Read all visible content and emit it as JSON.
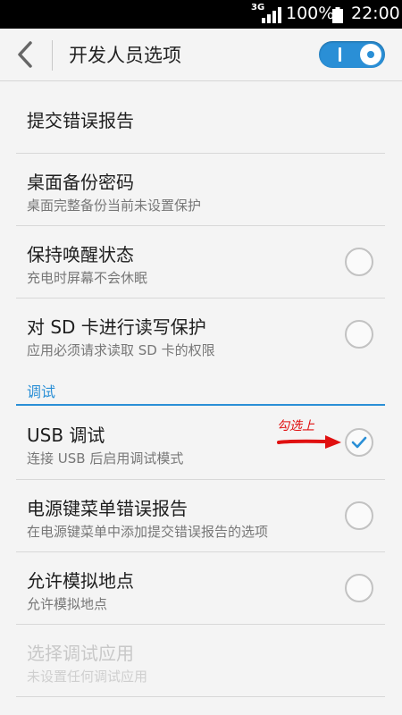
{
  "status_bar": {
    "network": "3G",
    "battery_percent": "100%",
    "time": "22:00"
  },
  "title_bar": {
    "title": "开发人员选项",
    "master_switch_on": true
  },
  "settings": [
    {
      "title": "提交错误报告",
      "subtitle": "",
      "control": "none"
    },
    {
      "title": "桌面备份密码",
      "subtitle": "桌面完整备份当前未设置保护",
      "control": "none"
    },
    {
      "title": "保持唤醒状态",
      "subtitle": "充电时屏幕不会休眠",
      "control": "radio",
      "checked": false
    },
    {
      "title": "对 SD 卡进行读写保护",
      "subtitle": "应用必须请求读取 SD 卡的权限",
      "control": "radio",
      "checked": false
    }
  ],
  "debug_section": {
    "header": "调试",
    "items": [
      {
        "title": "USB 调试",
        "subtitle": "连接 USB 后启用调试模式",
        "control": "radio",
        "checked": true
      },
      {
        "title": "电源键菜单错误报告",
        "subtitle": "在电源键菜单中添加提交错误报告的选项",
        "control": "radio",
        "checked": false
      },
      {
        "title": "允许模拟地点",
        "subtitle": "允许模拟地点",
        "control": "radio",
        "checked": false
      },
      {
        "title": "选择调试应用",
        "subtitle": "未设置任何调试应用",
        "control": "none",
        "disabled": true
      }
    ]
  },
  "annotation": {
    "text": "勾选上",
    "color": "#e01010"
  },
  "colors": {
    "accent": "#2a8fd6",
    "background": "#f4f4f4"
  }
}
